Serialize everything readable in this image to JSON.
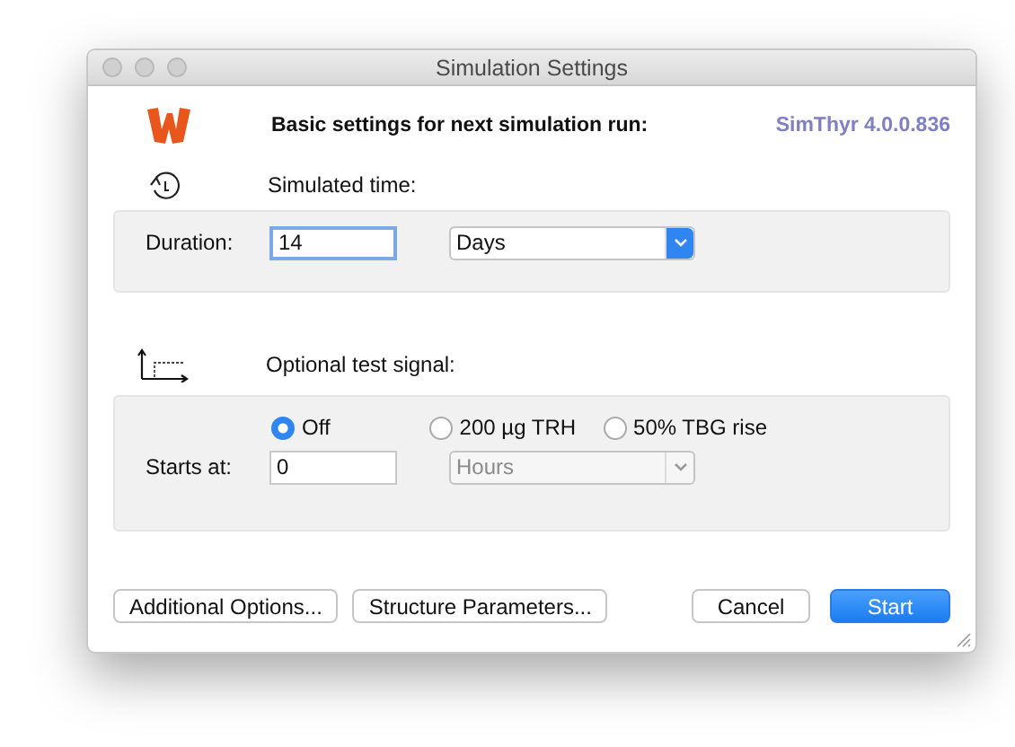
{
  "window": {
    "title": "Simulation Settings"
  },
  "header": {
    "heading": "Basic settings for next simulation run:",
    "version": "SimThyr 4.0.0.836"
  },
  "time_section": {
    "label": "Simulated time:",
    "duration_label": "Duration:",
    "duration_value": "14",
    "unit": {
      "value": "Days",
      "disabled": false
    }
  },
  "signal_section": {
    "label": "Optional test signal:",
    "options": [
      {
        "label": "Off",
        "selected": true
      },
      {
        "label": "200 µg TRH",
        "selected": false
      },
      {
        "label": "50% TBG rise",
        "selected": false
      }
    ],
    "starts_label": "Starts at:",
    "starts_value": "0",
    "unit": {
      "value": "Hours",
      "disabled": true
    }
  },
  "buttons": [
    {
      "label": "Additional Options...",
      "kind": "plain"
    },
    {
      "label": "Structure Parameters...",
      "kind": "plain"
    },
    {
      "label": "Cancel",
      "kind": "plain"
    },
    {
      "label": "Start",
      "kind": "default"
    }
  ]
}
